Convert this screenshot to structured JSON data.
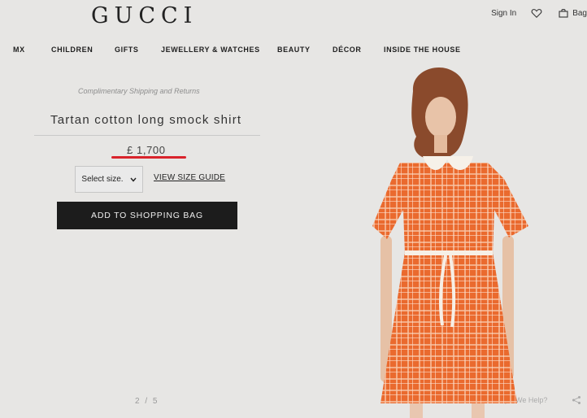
{
  "brand": {
    "logo": "GUCCI"
  },
  "header": {
    "sign_in": "Sign In",
    "bag_label": "Bag"
  },
  "nav": {
    "items": [
      "MX",
      "CHILDREN",
      "GIFTS",
      "JEWELLERY & WATCHES",
      "BEAUTY",
      "DÉCOR",
      "INSIDE THE HOUSE"
    ]
  },
  "product": {
    "shipping_note": "Complimentary Shipping and Returns",
    "title": "Tartan cotton long smock shirt",
    "price": "£ 1,700",
    "size_select": "Select size.",
    "size_guide": "VIEW SIZE GUIDE",
    "add_to_bag": "ADD TO SHOPPING BAG"
  },
  "gallery": {
    "pager": "2 / 5"
  },
  "footer": {
    "help": "We Help?"
  },
  "colors": {
    "background": "#e7e6e4",
    "button": "#1c1c1c",
    "highlight_underline": "#d9232b",
    "dress_orange": "#ea6a2e"
  },
  "icons": {
    "wishlist": "heart-icon",
    "bag": "shopping-bag-icon",
    "size_dropdown": "chevron-down-icon",
    "help": "chat-icon",
    "share": "share-icon"
  }
}
